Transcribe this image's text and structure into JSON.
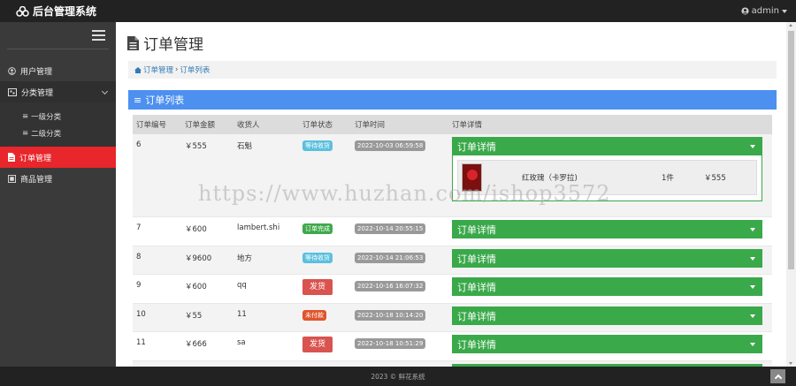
{
  "app": {
    "title": "后台管理系统",
    "user": "admin"
  },
  "sidebar": {
    "items": [
      {
        "label": "用户管理"
      },
      {
        "label": "分类管理",
        "subitems": [
          {
            "label": "一级分类"
          },
          {
            "label": "二级分类"
          }
        ]
      },
      {
        "label": "订单管理"
      },
      {
        "label": "商品管理"
      }
    ]
  },
  "page": {
    "title": "订单管理",
    "breadcrumb": [
      "订单管理",
      "订单列表"
    ],
    "panel_title": "订单列表"
  },
  "table": {
    "headers": [
      "订单编号",
      "订单金额",
      "收货人",
      "订单状态",
      "订单时间",
      "订单详情"
    ],
    "detail_label": "订单详情",
    "rows": [
      {
        "id": "6",
        "amount": "￥555",
        "receiver": "石魁",
        "status": "等待收货",
        "time": "2022-10-03 06:59:58",
        "expanded": true,
        "product": {
          "name": "红玫瑰（卡罗拉)",
          "qty": "1件",
          "price": "￥555"
        }
      },
      {
        "id": "7",
        "amount": "￥600",
        "receiver": "lambert.shi",
        "status": "订单完成",
        "time": "2022-10-14 20:55:15"
      },
      {
        "id": "8",
        "amount": "￥9600",
        "receiver": "地方",
        "status": "等待收货",
        "time": "2022-10-14 21:06:53"
      },
      {
        "id": "9",
        "amount": "￥600",
        "receiver": "qq",
        "status": "发货",
        "time": "2022-10-16 16:07:32"
      },
      {
        "id": "10",
        "amount": "￥55",
        "receiver": "11",
        "status": "未付款",
        "time": "2022-10-18 10:14:20"
      },
      {
        "id": "11",
        "amount": "￥666",
        "receiver": "sa",
        "status": "发货",
        "time": "2022-10-18 10:51:29"
      }
    ]
  },
  "watermark": "https://www.huzhan.com/ishop3572",
  "footer": {
    "text": "2023 © 鲜花系统"
  },
  "colors": {
    "accent_red": "#e8262b",
    "panel_blue": "#4d90f0",
    "detail_green": "#3aa94a"
  }
}
